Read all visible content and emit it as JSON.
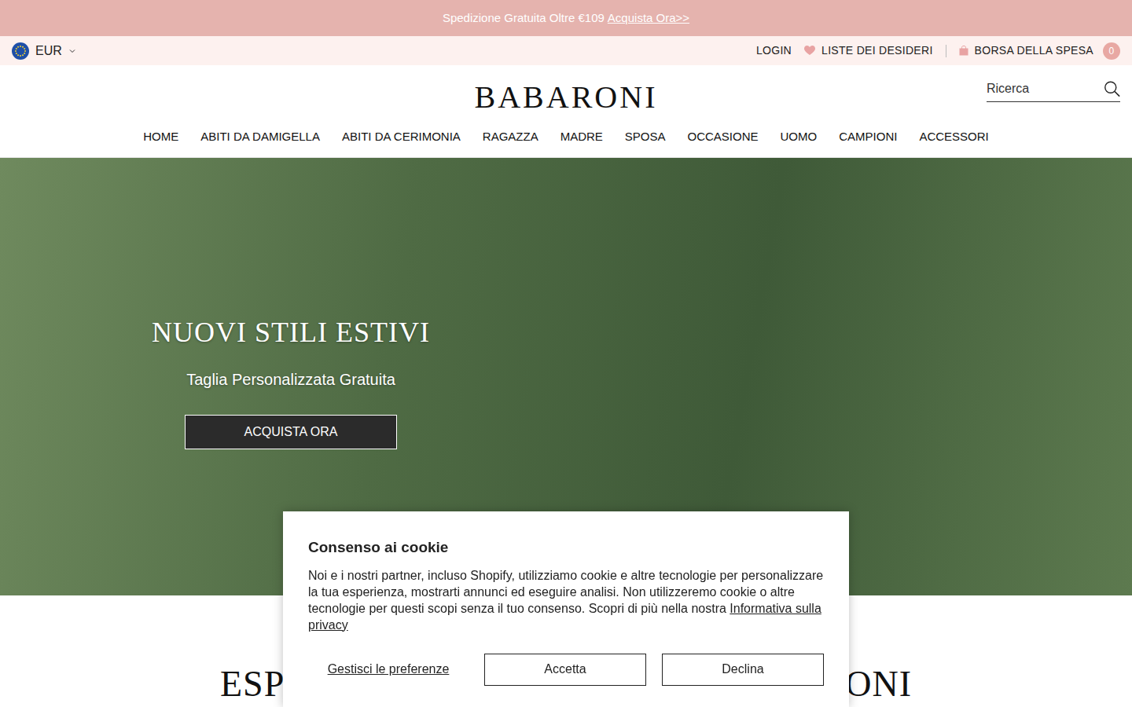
{
  "promo": {
    "text": "Spedizione Gratuita Oltre €109",
    "link": "Acquista Ora>>"
  },
  "topbar": {
    "currency": "EUR",
    "login": "LOGIN",
    "wishlist": "LISTE DEI DESIDERI",
    "cart": "BORSA DELLA SPESA",
    "cart_count": "0"
  },
  "logo": "BABARONI",
  "search": {
    "placeholder": "Ricerca"
  },
  "nav": [
    "HOME",
    "ABITI DA DAMIGELLA",
    "ABITI DA CERIMONIA",
    "RAGAZZA",
    "MADRE",
    "SPOSA",
    "OCCASIONE",
    "UOMO",
    "CAMPIONI",
    "ACCESSORI"
  ],
  "hero": {
    "title": "NUOVI STILI ESTIVI",
    "subtitle": "Taglia Personalizzata Gratuita",
    "button": "ACQUISTA ORA"
  },
  "section": {
    "heading_start": "ESP",
    "heading_end": "ONI"
  },
  "cookie": {
    "title": "Consenso ai cookie",
    "body": "Noi e i nostri partner, incluso Shopify, utilizziamo cookie e altre tecnologie per personalizzare la tua esperienza, mostrarti annunci ed eseguire analisi. Non utilizzeremo cookie o altre tecnologie per questi scopi senza il tuo consenso. Scopri di più nella nostra ",
    "link": "Informativa sulla privacy",
    "manage": "Gestisci le preferenze",
    "accept": "Accetta",
    "decline": "Declina"
  }
}
